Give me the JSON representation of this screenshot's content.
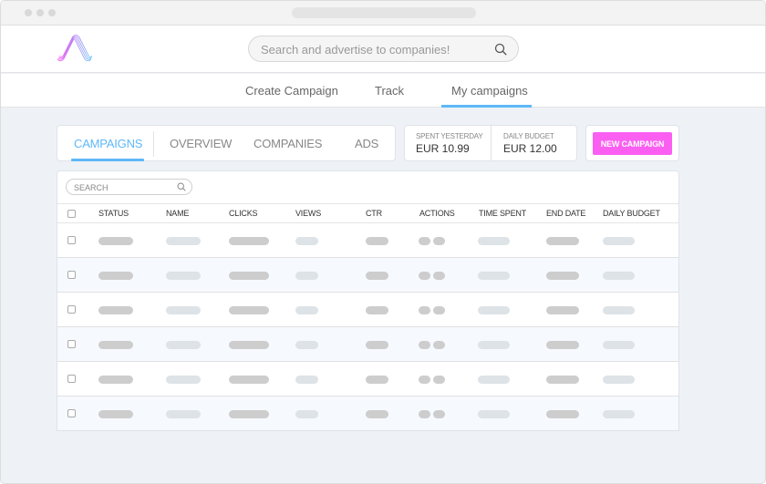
{
  "window": {
    "controls": [
      "close",
      "minimize",
      "maximize"
    ]
  },
  "header": {
    "logo": "waveform-logo",
    "search": {
      "placeholder": "Search and advertise to companies!",
      "value": "",
      "icon": "search-icon"
    }
  },
  "nav": {
    "items": [
      {
        "label": "Create Campaign",
        "active": false
      },
      {
        "label": "Track",
        "active": false
      },
      {
        "label": "My campaigns",
        "active": true
      }
    ]
  },
  "tabs": {
    "items": [
      {
        "label": "CAMPAIGNS",
        "active": true
      },
      {
        "label": "OVERVIEW",
        "active": false
      },
      {
        "label": "COMPANIES",
        "active": false
      },
      {
        "label": "ADS",
        "active": false
      }
    ]
  },
  "stats": {
    "spent_yesterday": {
      "label": "SPENT YESTERDAY",
      "value": "EUR 10.99"
    },
    "daily_budget": {
      "label": "DAILY BUDGET",
      "value": "EUR 12.00"
    }
  },
  "actions": {
    "new_campaign_label": "NEW CAMPAIGN"
  },
  "table": {
    "search": {
      "placeholder": "SEARCH",
      "value": ""
    },
    "columns": [
      "STATUS",
      "NAME",
      "CLICKS",
      "VIEWS",
      "CTR",
      "ACTIONS",
      "TIME SPENT",
      "END DATE",
      "DAILY BUDGET"
    ],
    "row_count": 6,
    "rows_state": "loading-placeholder"
  },
  "colors": {
    "accent": "#5eb8f7",
    "primary_button": "#fb5ff2",
    "background": "#eef1f6",
    "row_alt": "#f6f9fe"
  }
}
